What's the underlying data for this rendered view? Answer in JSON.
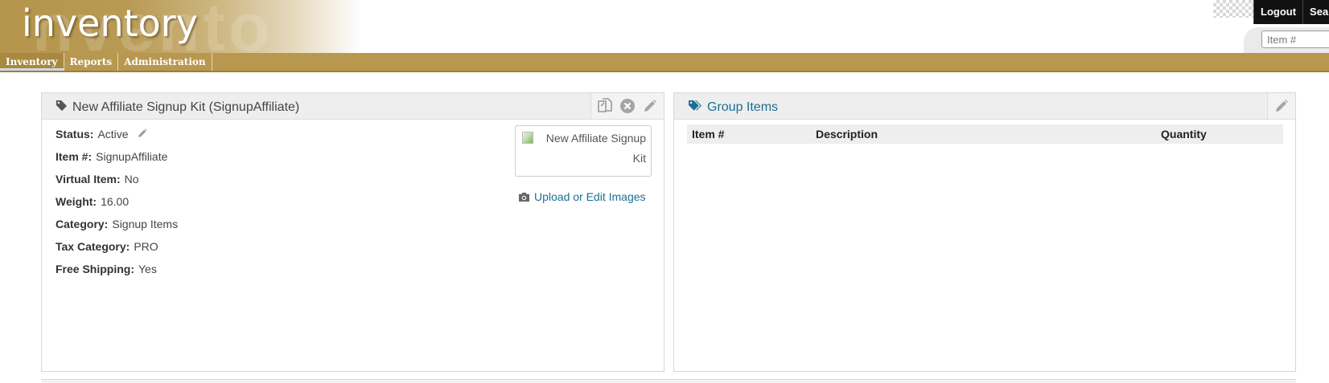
{
  "header": {
    "app_title": "inventory",
    "logout_label": "Logout",
    "search_label": "Sear",
    "search_placeholder": "Item #"
  },
  "nav": {
    "tabs": [
      {
        "label": "Inventory",
        "active": true
      },
      {
        "label": "Reports",
        "active": false
      },
      {
        "label": "Administration",
        "active": false
      }
    ]
  },
  "item_panel": {
    "title": "New Affiliate Signup Kit (SignupAffiliate)",
    "title_icon": "tag-icon",
    "tools": [
      "copy-icon",
      "delete-icon",
      "edit-icon"
    ],
    "fields": [
      {
        "label": "Status:",
        "value": "Active"
      },
      {
        "label": "Item #:",
        "value": "SignupAffiliate"
      },
      {
        "label": "Virtual Item:",
        "value": "No"
      },
      {
        "label": "Weight:",
        "value": "16.00"
      },
      {
        "label": "Category:",
        "value": "Signup Items"
      },
      {
        "label": "Tax Category:",
        "value": "PRO"
      },
      {
        "label": "Free Shipping:",
        "value": "Yes"
      }
    ],
    "image_alt": "New Affiliate Signup Kit",
    "upload_link": "Upload or Edit Images"
  },
  "group_panel": {
    "title": "Group Items",
    "title_icon": "tags-icon",
    "columns": [
      "Item #",
      "Description",
      "Quantity"
    ]
  },
  "colors": {
    "brand": "#b8974e",
    "link": "#1a6f96"
  }
}
